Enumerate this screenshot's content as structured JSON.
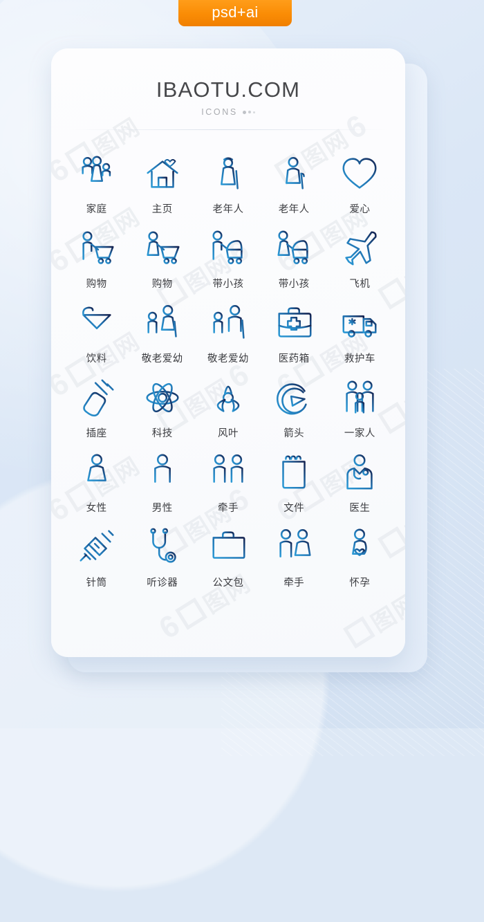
{
  "badge": {
    "label": "psd+ai",
    "color": "#f58a05"
  },
  "header": {
    "title": "IBAOTU.COM",
    "subtitle": "ICONS"
  },
  "watermark": {
    "text": "包图网",
    "mark": "6"
  },
  "theme": {
    "page_bg": "#dde8f5",
    "card_bg": "#fbfcfd",
    "icon_gradient_start": "#2b9ad6",
    "icon_gradient_end": "#15224f",
    "label_color": "#3b3c40",
    "title_color": "#46474a"
  },
  "grid": {
    "columns": 5,
    "rows": 6,
    "items": [
      {
        "label": "家庭",
        "icon": "family-icon"
      },
      {
        "label": "主页",
        "icon": "home-heart-icon"
      },
      {
        "label": "老年人",
        "icon": "elderly-woman-cane-icon"
      },
      {
        "label": "老年人",
        "icon": "elderly-man-cane-icon"
      },
      {
        "label": "爱心",
        "icon": "heart-icon"
      },
      {
        "label": "购物",
        "icon": "shopping-man-cart-icon"
      },
      {
        "label": "购物",
        "icon": "shopping-woman-cart-icon"
      },
      {
        "label": "带小孩",
        "icon": "man-stroller-icon"
      },
      {
        "label": "带小孩",
        "icon": "woman-stroller-icon"
      },
      {
        "label": "飞机",
        "icon": "airplane-icon"
      },
      {
        "label": "饮料",
        "icon": "cocktail-glass-icon"
      },
      {
        "label": "敬老爱幼",
        "icon": "woman-child-icon"
      },
      {
        "label": "敬老爱幼",
        "icon": "elder-child-icon"
      },
      {
        "label": "医药箱",
        "icon": "first-aid-kit-icon"
      },
      {
        "label": "救护车",
        "icon": "ambulance-icon"
      },
      {
        "label": "插座",
        "icon": "power-plug-icon"
      },
      {
        "label": "科技",
        "icon": "atom-icon"
      },
      {
        "label": "风叶",
        "icon": "fan-blade-icon"
      },
      {
        "label": "箭头",
        "icon": "circle-arrow-icon"
      },
      {
        "label": "一家人",
        "icon": "family-three-icon"
      },
      {
        "label": "女性",
        "icon": "female-icon"
      },
      {
        "label": "男性",
        "icon": "male-icon"
      },
      {
        "label": "牵手",
        "icon": "two-men-holding-hands-icon"
      },
      {
        "label": "文件",
        "icon": "clipboard-document-icon"
      },
      {
        "label": "医生",
        "icon": "doctor-icon"
      },
      {
        "label": "针筒",
        "icon": "syringe-icon"
      },
      {
        "label": "听诊器",
        "icon": "stethoscope-icon"
      },
      {
        "label": "公文包",
        "icon": "briefcase-icon"
      },
      {
        "label": "牵手",
        "icon": "couple-holding-hands-icon"
      },
      {
        "label": "怀孕",
        "icon": "pregnant-woman-icon"
      }
    ]
  }
}
